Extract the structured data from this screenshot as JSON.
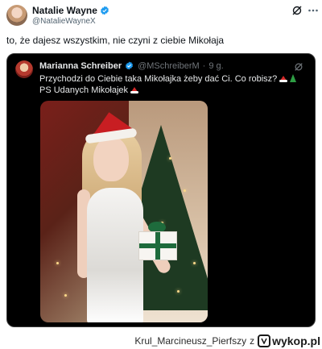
{
  "post": {
    "author_name": "Natalie Wayne",
    "author_handle": "@NatalieWayneX",
    "text": "to, że dajesz wszystkim, nie czyni z ciebie Mikołaja"
  },
  "quoted_post": {
    "author_name": "Marianna Schreiber",
    "author_handle": "@MSchreiberM",
    "separator": "·",
    "time_ago": "9 g.",
    "line1": "Przychodzi do Ciebie taka Mikołajka żeby dać Ci. Co robisz?",
    "line2": "PS Udanych Mikołajek",
    "emojis": [
      "santa-hat-emoji",
      "christmas-tree-emoji"
    ]
  },
  "watermark": {
    "username": "Krul_Marcineusz_Pierfszy",
    "prefix": "z",
    "site": "wykop.pl"
  },
  "colors": {
    "verified": "#1d9bf0",
    "quote_bg": "#000000",
    "quote_text": "#e7e9ea",
    "muted": "#71767b"
  }
}
